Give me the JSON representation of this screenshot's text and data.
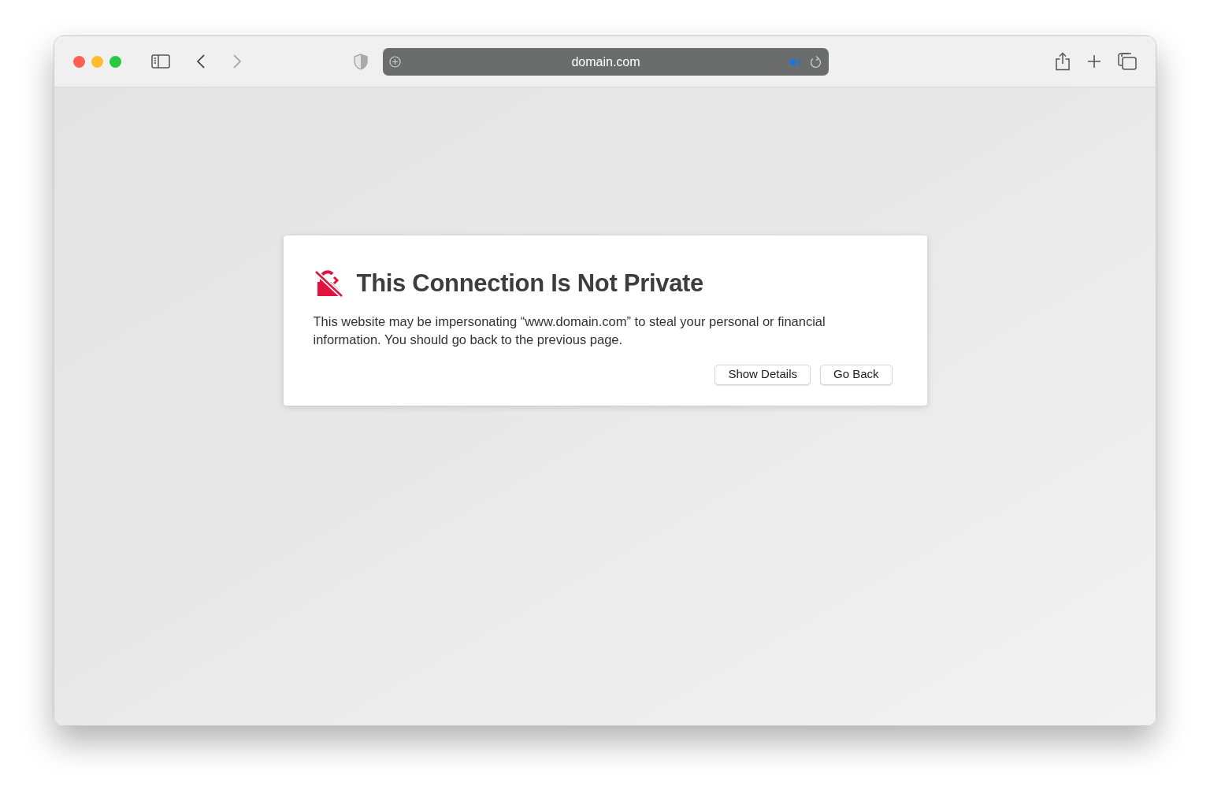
{
  "toolbar": {
    "navigation": [
      {
        "kind": "back",
        "disabled": false
      },
      {
        "kind": "forward",
        "disabled": true
      }
    ],
    "address_bar": {
      "url": "domain.com"
    }
  },
  "warning": {
    "title": "This Connection Is Not Private",
    "message": "This website may be impersonating “www.domain.com” to steal your personal or financial information. You should go back to the previous page.",
    "buttons": [
      "Show Details",
      "Go Back"
    ]
  }
}
